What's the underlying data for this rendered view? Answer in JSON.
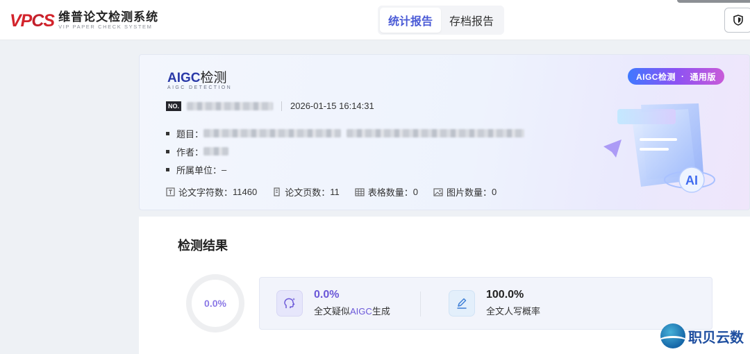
{
  "header": {
    "logo_mark_a": "VP",
    "logo_mark_c": "C",
    "logo_mark_b": "S",
    "logo_cn": "维普论文检测系统",
    "logo_en": "VIP PAPER CHECK SYSTEM",
    "tabs": [
      {
        "label": "统计报告",
        "active": true
      },
      {
        "label": "存档报告",
        "active": false
      }
    ]
  },
  "info": {
    "product_a": "AIGC",
    "product_b": "检测",
    "product_sub": "AIGC DETECTION",
    "badge_left": "AIGC检测",
    "badge_sep": "·",
    "badge_right": "通用版",
    "no_label": "NO.",
    "date": "2026-01-15 16:14:31",
    "meta": [
      {
        "label": "题目："
      },
      {
        "label": "作者："
      },
      {
        "label": "所属单位：",
        "value": "–"
      }
    ],
    "stats": [
      {
        "label": "论文字符数：",
        "value": "11460"
      },
      {
        "label": "论文页数：",
        "value": "11"
      },
      {
        "label": "表格数量：",
        "value": "0"
      },
      {
        "label": "图片数量：",
        "value": "0"
      }
    ],
    "illus_text": "AI"
  },
  "result": {
    "title": "检测结果",
    "ring_value": "0.0%",
    "aigc_value": "0.0%",
    "aigc_label_a": "全文疑似",
    "aigc_label_hl": "AIGC",
    "aigc_label_b": "生成",
    "human_value": "100.0%",
    "human_label": "全文人写概率"
  },
  "watermark": {
    "text": "职贝云数"
  },
  "colors": {
    "accent": "#4a5ad6",
    "purple": "#6b58d8",
    "brand_red": "#d3232b"
  }
}
